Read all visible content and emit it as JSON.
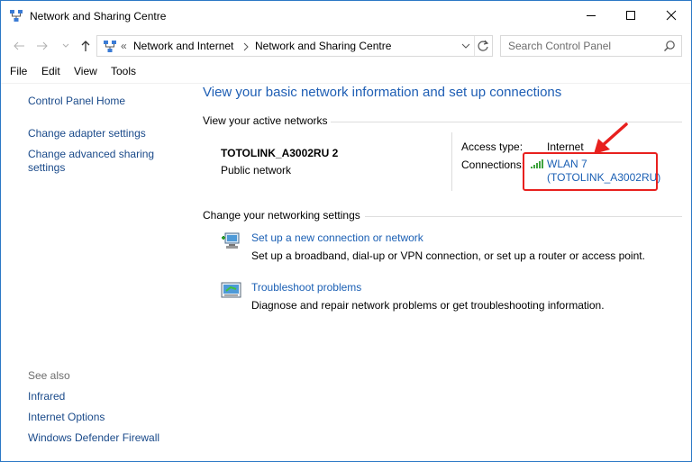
{
  "window": {
    "title": "Network and Sharing Centre"
  },
  "address": {
    "overflow": "«",
    "crumbs": [
      "Network and Internet",
      "Network and Sharing Centre"
    ],
    "search_placeholder": "Search Control Panel"
  },
  "menu": [
    "File",
    "Edit",
    "View",
    "Tools"
  ],
  "sidebar": {
    "links": [
      "Control Panel Home",
      "Change adapter settings",
      "Change advanced sharing settings"
    ],
    "see_also_label": "See also",
    "see_also": [
      "Infrared",
      "Internet Options",
      "Windows Defender Firewall"
    ]
  },
  "main": {
    "title": "View your basic network information and set up connections",
    "active_networks_label": "View your active networks",
    "network": {
      "name": "TOTOLINK_A3002RU 2",
      "type": "Public network",
      "access_type_label": "Access type:",
      "access_type_value": "Internet",
      "connections_label": "Connections:",
      "connection_line1": "WLAN 7",
      "connection_line2": "(TOTOLINK_A3002RU)"
    },
    "settings_label": "Change your networking settings",
    "tasks": [
      {
        "link": "Set up a new connection or network",
        "desc": "Set up a broadband, dial-up or VPN connection, or set up a router or access point."
      },
      {
        "link": "Troubleshoot problems",
        "desc": "Diagnose and repair network problems or get troubleshooting information."
      }
    ]
  },
  "colors": {
    "link": "#1a5fb4",
    "title": "#1e5eb4",
    "annotation": "#e8201e"
  }
}
